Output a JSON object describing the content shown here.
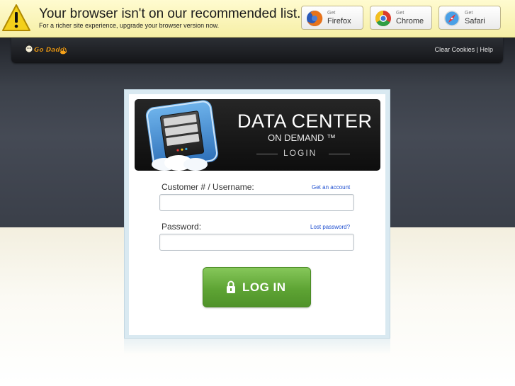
{
  "warning": {
    "title": "Your browser isn't on our recommended list.",
    "subtitle": "For a richer site experience, upgrade your browser version now.",
    "browsers": [
      {
        "get": "Get",
        "name": "Firefox",
        "icon": "firefox-icon"
      },
      {
        "get": "Get",
        "name": "Chrome",
        "icon": "chrome-icon"
      },
      {
        "get": "Get",
        "name": "Safari",
        "icon": "safari-icon"
      }
    ]
  },
  "header": {
    "logo_text": "Go Daddy",
    "clear_cookies": "Clear Cookies",
    "separator": "|",
    "help": "Help"
  },
  "banner": {
    "title": "DATA CENTER",
    "subtitle": "ON DEMAND ™",
    "login": "LOGIN"
  },
  "form": {
    "username_label": "Customer # / Username:",
    "get_account": "Get an account",
    "username_value": "",
    "password_label": "Password:",
    "lost_password": "Lost password?",
    "password_value": "",
    "login_button": "LOG IN"
  },
  "colors": {
    "warning_bg": "#fdf7c4",
    "header_dark": "#1b1c20",
    "login_green": "#5ea434",
    "link_blue": "#1f4fd0"
  }
}
